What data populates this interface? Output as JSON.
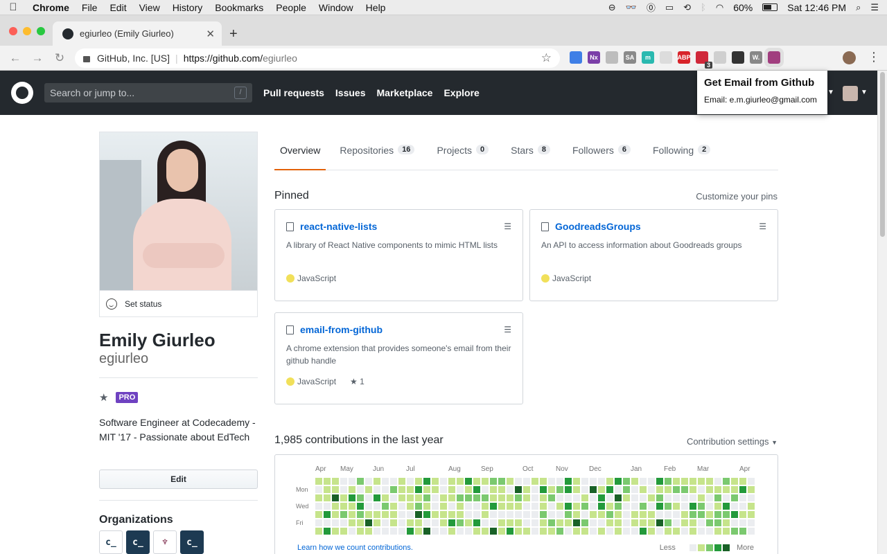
{
  "menubar": {
    "app": "Chrome",
    "items": [
      "File",
      "Edit",
      "View",
      "History",
      "Bookmarks",
      "People",
      "Window",
      "Help"
    ],
    "battery": "60%",
    "clock": "Sat 12:46 PM"
  },
  "browser": {
    "tab_title": "egiurleo (Emily Giurleo)",
    "site_identity": "GitHub, Inc. [US]",
    "url_host": "https://github.com/",
    "url_path": "egiurleo",
    "extensions": [
      {
        "name": "color-picker-icon",
        "label": "",
        "color": "#3f7fe6"
      },
      {
        "name": "onenote-icon",
        "label": "Nx",
        "color": "#7b3fa8"
      },
      {
        "name": "extension-icon",
        "label": "",
        "color": "#bdbdbd"
      },
      {
        "name": "sa-icon",
        "label": "SA",
        "color": "#8a8a8a"
      },
      {
        "name": "m-icon",
        "label": "m",
        "color": "#2ab9b0"
      },
      {
        "name": "react-icon",
        "label": "",
        "color": "#dcdcdc"
      },
      {
        "name": "adblock-icon",
        "label": "ABP",
        "color": "#d8232a"
      },
      {
        "name": "todoist-icon",
        "label": "",
        "color": "#d0283a",
        "badge": "3"
      },
      {
        "name": "refresh-icon",
        "label": "",
        "color": "#cfcfcf"
      },
      {
        "name": "onepassword-icon",
        "label": "",
        "color": "#333333"
      },
      {
        "name": "w-icon",
        "label": "W.",
        "color": "#888888"
      },
      {
        "name": "email-extension-icon",
        "label": "",
        "color": "#a13e7f",
        "active": true
      }
    ]
  },
  "github_header": {
    "search_placeholder": "Search or jump to...",
    "search_key": "/",
    "nav": [
      "Pull requests",
      "Issues",
      "Marketplace",
      "Explore"
    ]
  },
  "popup": {
    "title": "Get Email from Github",
    "body": "Email: e.m.giurleo@gmail.com"
  },
  "profile": {
    "set_status": "Set status",
    "full_name": "Emily Giurleo",
    "login": "egiurleo",
    "pro_badge": "PRO",
    "bio": "Software Engineer at Codecademy - MIT '17 - Passionate about EdTech",
    "edit_button": "Edit",
    "organizations_title": "Organizations",
    "orgs": [
      {
        "label": "c_",
        "bg": "#ffffff",
        "fg": "#1b3a52"
      },
      {
        "label": "c_",
        "bg": "#1d3a52",
        "fg": "#ffffff"
      },
      {
        "label": "♆",
        "bg": "#ffffff",
        "fg": "#7a2447"
      },
      {
        "label": "c_",
        "bg": "#1d3a52",
        "fg": "#ffffff"
      }
    ]
  },
  "tabs": [
    {
      "label": "Overview",
      "count": null,
      "active": true
    },
    {
      "label": "Repositories",
      "count": "16"
    },
    {
      "label": "Projects",
      "count": "0"
    },
    {
      "label": "Stars",
      "count": "8"
    },
    {
      "label": "Followers",
      "count": "6"
    },
    {
      "label": "Following",
      "count": "2"
    }
  ],
  "pinned": {
    "title": "Pinned",
    "customize": "Customize your pins",
    "repos": [
      {
        "name": "react-native-lists",
        "desc": "A library of React Native components to mimic HTML lists",
        "lang": "JavaScript",
        "stars": null
      },
      {
        "name": "GoodreadsGroups",
        "desc": "An API to access information about Goodreads groups",
        "lang": "JavaScript",
        "stars": null
      },
      {
        "name": "email-from-github",
        "desc": "A chrome extension that provides someone's email from their github handle",
        "lang": "JavaScript",
        "stars": "1"
      }
    ]
  },
  "contributions": {
    "title": "1,985 contributions in the last year",
    "settings": "Contribution settings",
    "months": [
      "Apr",
      "May",
      "Jun",
      "Jul",
      "Aug",
      "Sep",
      "Oct",
      "Nov",
      "Dec",
      "Jan",
      "Feb",
      "Mar",
      "Apr"
    ],
    "days": [
      "Mon",
      "Wed",
      "Fri"
    ],
    "learn": "Learn how we count contributions.",
    "legend_less": "Less",
    "legend_more": "More",
    "colors": [
      "#ebedf0",
      "#c6e48b",
      "#7bc96f",
      "#239a3b",
      "#196127"
    ]
  }
}
